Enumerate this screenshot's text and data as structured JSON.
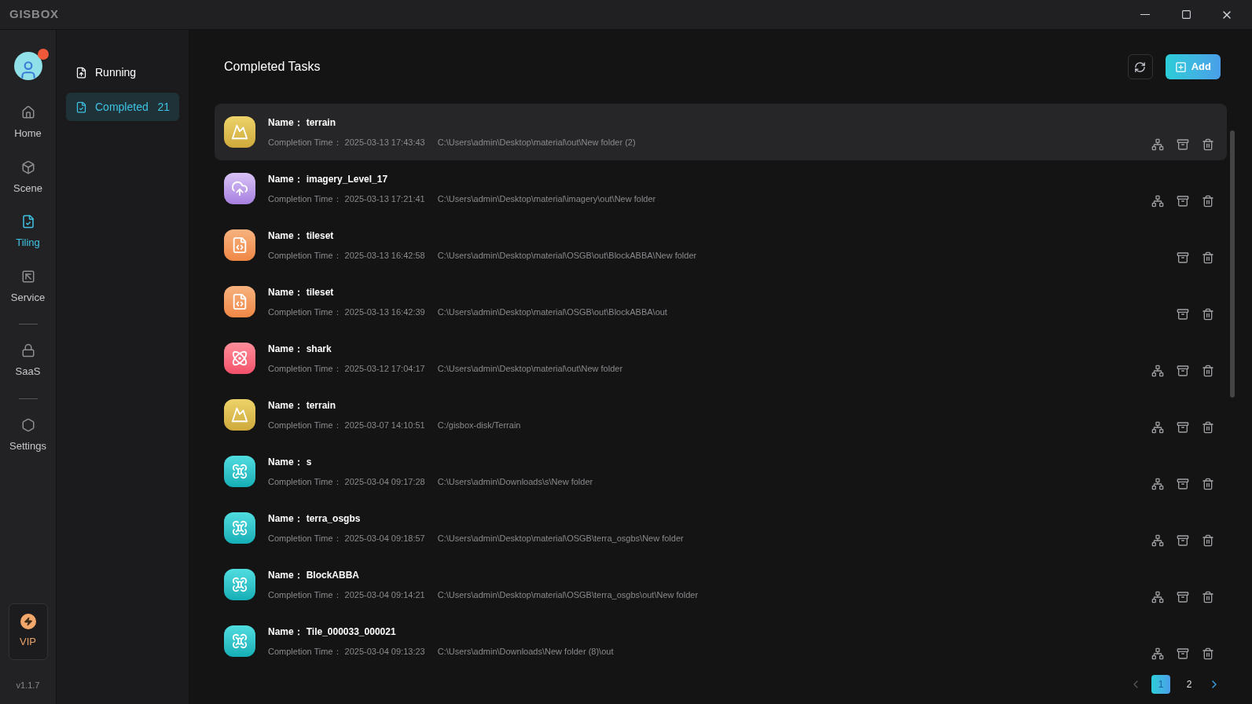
{
  "app": {
    "logo": "GISBOX",
    "version": "v1.1.7"
  },
  "rail_groups": [
    [
      {
        "label": "Home",
        "selected": false
      },
      {
        "label": "Scene",
        "selected": false
      },
      {
        "label": "Tiling",
        "selected": true
      },
      {
        "label": "Service",
        "selected": false
      }
    ],
    [
      {
        "label": "SaaS",
        "selected": false
      }
    ],
    [
      {
        "label": "Settings",
        "selected": false
      }
    ]
  ],
  "vip": {
    "label": "VIP"
  },
  "subnav": [
    {
      "label": "Running",
      "selected": false
    },
    {
      "label": "Completed",
      "selected": true,
      "count": "21"
    }
  ],
  "header": {
    "title": "Completed Tasks",
    "add_button": "Add"
  },
  "tasks": [
    {
      "kind": "terrain",
      "name_label": "Name：",
      "name": "terrain",
      "time_label": "Completion Time：",
      "time": "2025-03-13 17:43:43",
      "path": "C:\\Users\\admin\\Desktop\\material\\out\\New folder (2)",
      "has_structure": true,
      "selected": true
    },
    {
      "kind": "imagery",
      "name_label": "Name：",
      "name": "imagery_Level_17",
      "time_label": "Completion Time：",
      "time": "2025-03-13 17:21:41",
      "path": "C:\\Users\\admin\\Desktop\\material\\imagery\\out\\New folder",
      "has_structure": true,
      "selected": false
    },
    {
      "kind": "tileset",
      "name_label": "Name：",
      "name": "tileset",
      "time_label": "Completion Time：",
      "time": "2025-03-13 16:42:58",
      "path": "C:\\Users\\admin\\Desktop\\material\\OSGB\\out\\BlockABBA\\New folder",
      "has_structure": false,
      "selected": false
    },
    {
      "kind": "tileset",
      "name_label": "Name：",
      "name": "tileset",
      "time_label": "Completion Time：",
      "time": "2025-03-13 16:42:39",
      "path": "C:\\Users\\admin\\Desktop\\material\\OSGB\\out\\BlockABBA\\out",
      "has_structure": false,
      "selected": false
    },
    {
      "kind": "model",
      "name_label": "Name：",
      "name": "shark",
      "time_label": "Completion Time：",
      "time": "2025-03-12 17:04:17",
      "path": "C:\\Users\\admin\\Desktop\\material\\out\\New folder",
      "has_structure": true,
      "selected": false
    },
    {
      "kind": "terrain",
      "name_label": "Name：",
      "name": "terrain",
      "time_label": "Completion Time：",
      "time": "2025-03-07 14:10:51",
      "path": "C:/gisbox-disk/Terrain",
      "has_structure": true,
      "selected": false
    },
    {
      "kind": "osgb",
      "name_label": "Name：",
      "name": "s",
      "time_label": "Completion Time：",
      "time": "2025-03-04 09:17:28",
      "path": "C:\\Users\\admin\\Downloads\\s\\New folder",
      "has_structure": true,
      "selected": false
    },
    {
      "kind": "osgb",
      "name_label": "Name：",
      "name": "terra_osgbs",
      "time_label": "Completion Time：",
      "time": "2025-03-04 09:18:57",
      "path": "C:\\Users\\admin\\Desktop\\material\\OSGB\\terra_osgbs\\New folder",
      "has_structure": true,
      "selected": false
    },
    {
      "kind": "osgb",
      "name_label": "Name：",
      "name": "BlockABBA",
      "time_label": "Completion Time：",
      "time": "2025-03-04 09:14:21",
      "path": "C:\\Users\\admin\\Desktop\\material\\OSGB\\terra_osgbs\\out\\New folder",
      "has_structure": true,
      "selected": false
    },
    {
      "kind": "osgb",
      "name_label": "Name：",
      "name": "Tile_000033_000021",
      "time_label": "Completion Time：",
      "time": "2025-03-04 09:13:23",
      "path": "C:\\Users\\admin\\Downloads\\New folder (8)\\out",
      "has_structure": true,
      "selected": false
    }
  ],
  "pagination": {
    "prev_disabled": true,
    "next_disabled": false,
    "pages": [
      {
        "label": "1",
        "selected": true
      },
      {
        "label": "2",
        "selected": false
      }
    ]
  }
}
